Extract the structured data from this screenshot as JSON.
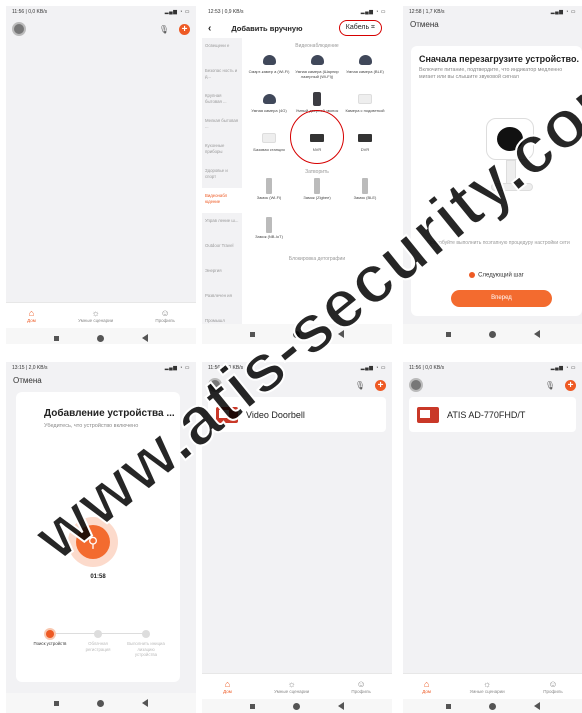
{
  "screens": {
    "s1": {
      "status_time": "11:56 | 0,0 KB/s",
      "tabs": [
        "Дом",
        "Умные сценарии",
        "Профиль"
      ]
    },
    "s2": {
      "status_time": "12:53 | 0,9 KB/s",
      "title": "Добавить вручную",
      "cable": "Кабель",
      "categories": [
        "Освещени е",
        "Безопас ность и д...",
        "Крупная бытовая ...",
        "Мелкая бытовая ...",
        "Кухонные приборы",
        "Здоровье и спорт",
        "Видеонабл юдение",
        "Управ ление ш...",
        "Outdoor Travel",
        "Энергия",
        "Развлечен ия",
        "Промышл енность ..."
      ],
      "section1": "Видеонаблюдение",
      "devices": [
        "Смарт-камер а (Wi-Fi)",
        "Умная камера (Шарнир лазерный (Wi-Fi))",
        "Умная камера (BLE)",
        "Умная камера (4G)",
        "Умный дверной звонок",
        "Камера с подсветкой",
        "Базовая станция",
        "NVR",
        "DVR"
      ],
      "section2": "Затворить",
      "locks": [
        "Замок (Wi-Fi)",
        "Замок (Zigbee)",
        "Замок (BLE)",
        "Замок (NB-IoT)"
      ],
      "section3": "Блокировка детографии"
    },
    "s3": {
      "status_time": "12:58 | 1,7 KB/s",
      "cancel": "Отмена",
      "title": "Сначала перезагрузите устройство.",
      "desc": "Включите питание, подтвердите, что индикатор медленно мигает или вы слышите звуковой сигнал",
      "retry": "Попробуйте выполнить поэтапную процедуру настройки сети",
      "next_step": "Следующий шаг",
      "button": "Вперед"
    },
    "s4": {
      "status_time": "13:15 | 2,0 KB/s",
      "cancel": "Отмена",
      "title": "Добавление устройства ...",
      "sub": "Убедитесь, что устройство включено",
      "timer": "01:58",
      "steps": [
        "Поиск устройств",
        "Облачная регистрация",
        "Выполнить инициа лизацию устройства"
      ]
    },
    "s5": {
      "status_time": "11:56 | 0,0 KB/s",
      "device": "Video Doorbell",
      "tabs": [
        "Дом",
        "Умные сценарии",
        "Профиль"
      ]
    },
    "s6": {
      "status_time": "11:56 | 0,0 KB/s",
      "device": "ATIS AD-770FHD/T",
      "tabs": [
        "Дом",
        "Умные сценарии",
        "Профиль"
      ]
    }
  },
  "watermark": "www.atis-security.com",
  "colors": {
    "accent": "#ee5a24",
    "annotation": "#d60000"
  }
}
